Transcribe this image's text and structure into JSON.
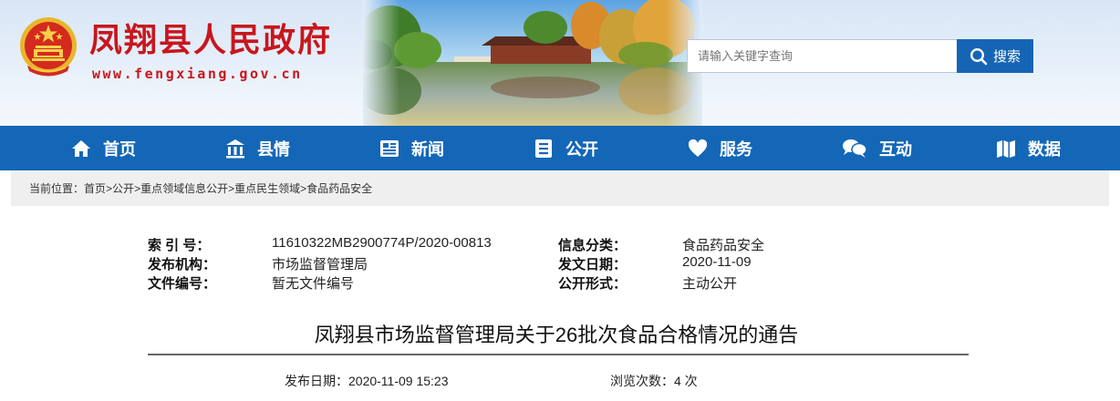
{
  "header": {
    "site_name": "凤翔县人民政府",
    "site_url": "www.fengxiang.gov.cn",
    "emblem_icon": "national-emblem-icon",
    "brand_color": "#c8161d"
  },
  "search": {
    "placeholder": "请输入关键字查询",
    "button_label": "搜索",
    "button_icon": "search-icon"
  },
  "nav": {
    "color": "#1467b6",
    "items": [
      {
        "label": "首页",
        "icon": "home-icon"
      },
      {
        "label": "县情",
        "icon": "landmark-icon"
      },
      {
        "label": "新闻",
        "icon": "newspaper-icon"
      },
      {
        "label": "公开",
        "icon": "list-document-icon"
      },
      {
        "label": "服务",
        "icon": "heart-icon"
      },
      {
        "label": "互动",
        "icon": "chat-bubbles-icon"
      },
      {
        "label": "数据",
        "icon": "map-icon"
      }
    ]
  },
  "breadcrumb": {
    "prefix": "当前位置：",
    "items": [
      "首页",
      "公开",
      "重点领域信息公开",
      "重点民生领域",
      "食品药品安全"
    ],
    "separator": ">"
  },
  "meta": {
    "index_label": "索 引 号：",
    "index_value": "11610322MB2900774P/2020-00813",
    "category_label": "信息分类：",
    "category_value": "食品药品安全",
    "publisher_label": "发布机构：",
    "publisher_value": "市场监督管理局",
    "date_label": "发文日期：",
    "date_value": "2020-11-09",
    "docno_label": "文件编号：",
    "docno_value": "暂无文件编号",
    "form_label": "公开形式：",
    "form_value": "主动公开"
  },
  "article": {
    "title": "凤翔县市场监督管理局关于26批次食品合格情况的通告",
    "publish_date_label": "发布日期：",
    "publish_date_value": "2020-11-09 15:23",
    "views_label": "浏览次数：",
    "views_value": "4 次"
  }
}
